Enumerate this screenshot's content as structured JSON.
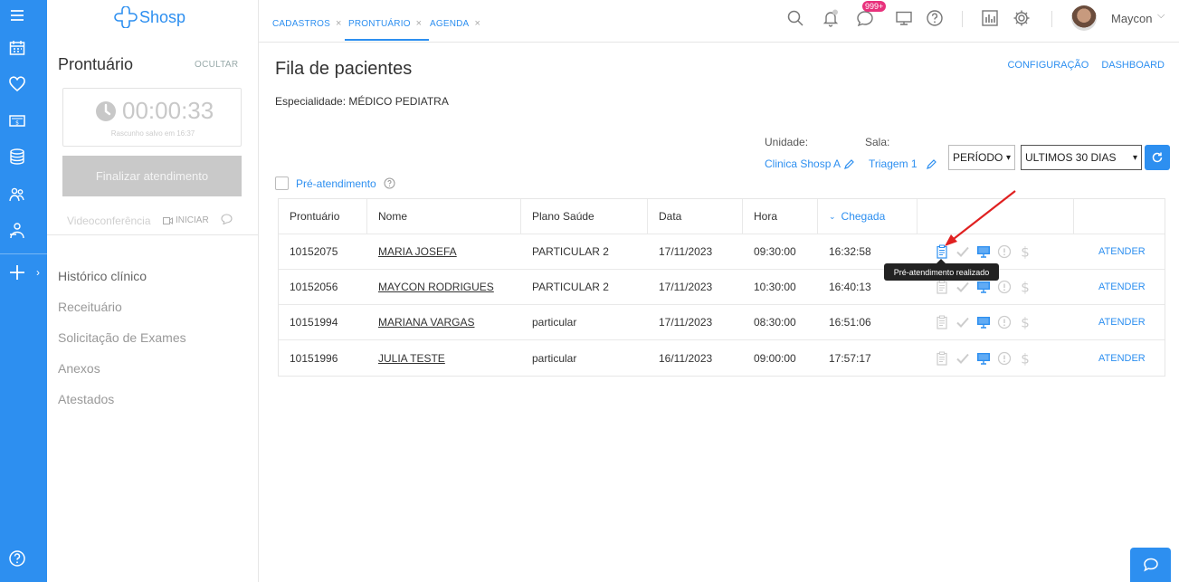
{
  "app": {
    "brand": "Shosp",
    "accent": "#2d8ff0"
  },
  "tabs": [
    {
      "label": "CADASTROS"
    },
    {
      "label": "PRONTUÁRIO"
    },
    {
      "label": "AGENDA"
    }
  ],
  "header": {
    "badge": "999+",
    "user_name": "Maycon"
  },
  "sidebar": {
    "title": "Prontuário",
    "hide_label": "OCULTAR",
    "timer": "00:00:33",
    "draft_note": "Rascunho salvo em 16:37",
    "finish_label": "Finalizar atendimento",
    "video_label": "Videoconferência",
    "video_start": "INICIAR",
    "menu": [
      {
        "label": "Histórico clínico"
      },
      {
        "label": "Receituário"
      },
      {
        "label": "Solicitação de Exames"
      },
      {
        "label": "Anexos"
      },
      {
        "label": "Atestados"
      }
    ]
  },
  "main": {
    "title": "Fila de pacientes",
    "links": {
      "config": "CONFIGURAÇÃO",
      "dashboard": "DASHBOARD"
    },
    "specialty": "Especialidade: MÉDICO PEDIATRA",
    "unit_label": "Unidade:",
    "unit_value": "Clinica Shosp A",
    "room_label": "Sala:",
    "room_value": "Triagem 1",
    "period_select": "PERÍODO",
    "range_select": "ULTIMOS 30 DIAS",
    "pre_checkbox": "Pré-atendimento",
    "columns": {
      "prontuario": "Prontuário",
      "nome": "Nome",
      "plano": "Plano Saúde",
      "data": "Data",
      "hora": "Hora",
      "chegada": "Chegada"
    },
    "rows": [
      {
        "prontuario": "10152075",
        "nome": "MARIA JOSEFA",
        "plano": "PARTICULAR 2",
        "data": "17/11/2023",
        "hora": "09:30:00",
        "chegada": "16:32:58",
        "action": "ATENDER"
      },
      {
        "prontuario": "10152056",
        "nome": "MAYCON RODRIGUES",
        "plano": "PARTICULAR 2",
        "data": "17/11/2023",
        "hora": "10:30:00",
        "chegada": "16:40:13",
        "action": "ATENDER"
      },
      {
        "prontuario": "10151994",
        "nome": "MARIANA VARGAS",
        "plano": "particular",
        "data": "17/11/2023",
        "hora": "08:30:00",
        "chegada": "16:51:06",
        "action": "ATENDER"
      },
      {
        "prontuario": "10151996",
        "nome": "JULIA TESTE",
        "plano": "particular",
        "data": "16/11/2023",
        "hora": "09:00:00",
        "chegada": "17:57:17",
        "action": "ATENDER"
      }
    ],
    "tooltip": "Pré-atendimento realizado"
  }
}
